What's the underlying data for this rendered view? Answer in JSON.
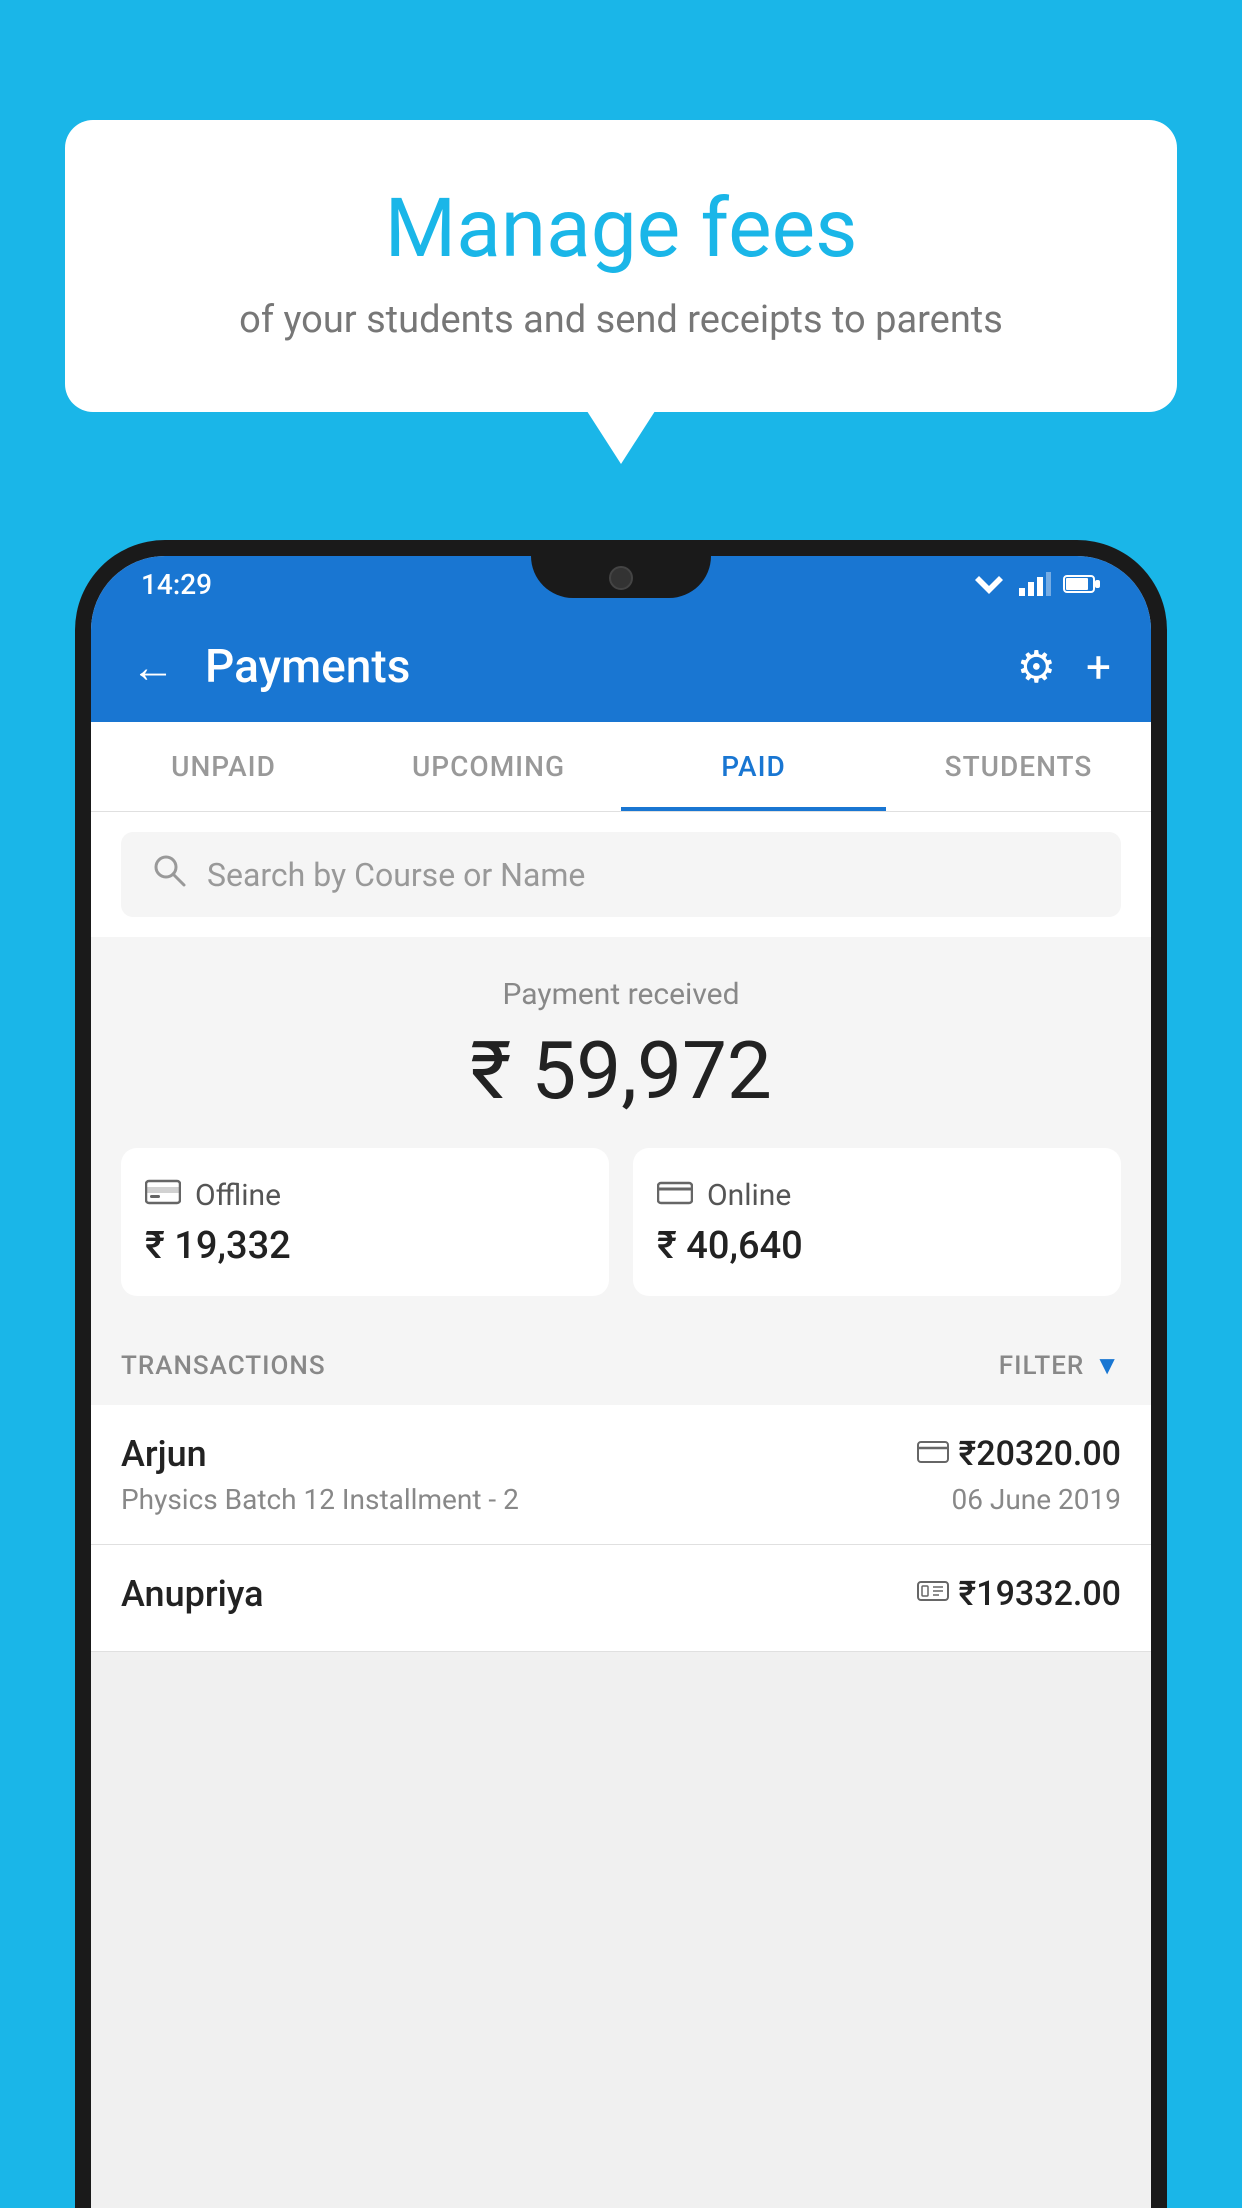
{
  "bubble": {
    "title": "Manage fees",
    "subtitle": "of your students and send receipts to parents"
  },
  "status_bar": {
    "time": "14:29"
  },
  "app_bar": {
    "title": "Payments",
    "back_label": "←",
    "gear_label": "⚙",
    "plus_label": "+"
  },
  "tabs": [
    {
      "label": "UNPAID",
      "active": false
    },
    {
      "label": "UPCOMING",
      "active": false
    },
    {
      "label": "PAID",
      "active": true
    },
    {
      "label": "STUDENTS",
      "active": false
    }
  ],
  "search": {
    "placeholder": "Search by Course or Name"
  },
  "payment_summary": {
    "label": "Payment received",
    "amount": "₹ 59,972",
    "offline": {
      "type": "Offline",
      "amount": "₹ 19,332"
    },
    "online": {
      "type": "Online",
      "amount": "₹ 40,640"
    }
  },
  "transactions": {
    "label": "TRANSACTIONS",
    "filter_label": "FILTER",
    "rows": [
      {
        "name": "Arjun",
        "detail": "Physics Batch 12 Installment - 2",
        "amount": "₹20320.00",
        "date": "06 June 2019",
        "icon": "card"
      },
      {
        "name": "Anupriya",
        "detail": "",
        "amount": "₹19332.00",
        "date": "",
        "icon": "cash"
      }
    ]
  }
}
